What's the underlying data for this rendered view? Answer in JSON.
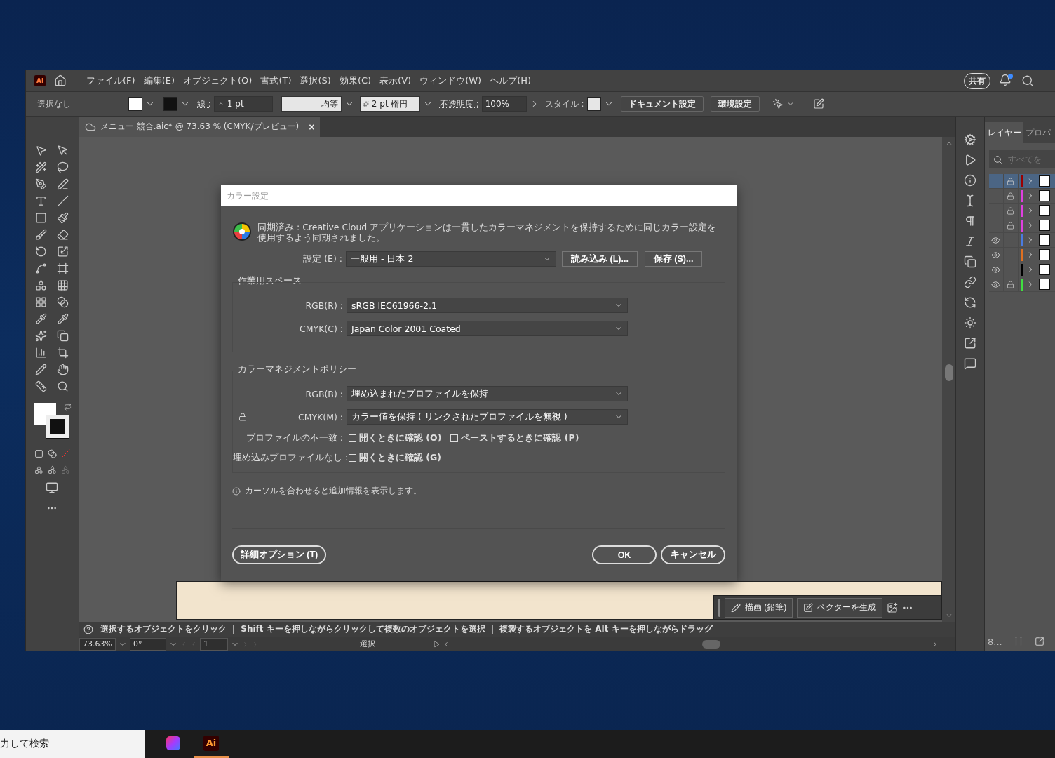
{
  "menubar": {
    "app_badge": "Ai",
    "menus": [
      "ファイル(F)",
      "編集(E)",
      "オブジェクト(O)",
      "書式(T)",
      "選択(S)",
      "効果(C)",
      "表示(V)",
      "ウィンドウ(W)",
      "ヘルプ(H)"
    ],
    "share": "共有",
    "has_notification": true
  },
  "control_bar": {
    "selection": "選択なし",
    "stroke_label": "線 :",
    "stroke_weight": "1 pt",
    "stroke_profile": "均等",
    "brush": "2 pt 楕円",
    "opacity_label": "不透明度 :",
    "opacity": "100%",
    "style_label": "スタイル :",
    "buttons": [
      "ドキュメント設定",
      "環境設定"
    ]
  },
  "document_tab": {
    "title": "メニュー 競合.aic* @ 73.63 % (CMYK/プレビュー)",
    "close": "×"
  },
  "dialog": {
    "title": "カラー設定",
    "sync_message": "同期済み : Creative Cloud アプリケーションは一貫したカラーマネジメントを保持するために同じカラー設定を使用するよう同期されました。",
    "settings": {
      "label": "設定 (E) :",
      "value": "一般用 - 日本 2"
    },
    "load_button": "読み込み (L)...",
    "save_button": "保存 (S)...",
    "working_spaces": {
      "title": "作業用スペース",
      "rows": [
        {
          "label": "RGB(R) :",
          "value": "sRGB IEC61966-2.1"
        },
        {
          "label": "CMYK(C) :",
          "value": "Japan Color 2001 Coated"
        }
      ]
    },
    "policies": {
      "title": "カラーマネジメントポリシー",
      "rows": [
        {
          "label": "RGB(B) :",
          "value": "埋め込まれたプロファイルを保持",
          "locked": false
        },
        {
          "label": "CMYK(M) :",
          "value": "カラー値を保持 ( リンクされたプロファイルを無視 )",
          "locked": true
        }
      ],
      "checks": [
        {
          "label": "プロファイルの不一致 :",
          "options": [
            {
              "label": "開くときに確認 (O)",
              "checked": false
            },
            {
              "label": "ペーストするときに確認 (P)",
              "checked": false
            }
          ]
        },
        {
          "label": "埋め込みプロファイルなし :",
          "options": [
            {
              "label": "開くときに確認 (G)",
              "checked": false
            }
          ]
        }
      ]
    },
    "hint": "カーソルを合わせると追加情報を表示します。",
    "advanced_button": "詳細オプション (T)",
    "ok_button": "OK",
    "cancel_button": "キャンセル"
  },
  "floating_bar": {
    "buttons": [
      "描画 (鉛筆)",
      "ベクターを生成"
    ]
  },
  "status": {
    "hint": "選択するオブジェクトをクリック ｜ Shift キーを押しながらクリックして複数のオブジェクトを選択 ｜ 複製するオブジェクトを Alt キーを押しながらドラッグ",
    "zoom": "73.63%",
    "rotation": "0°",
    "artboard": "1",
    "tool": "選択"
  },
  "layers_panel": {
    "tabs": [
      {
        "label": "レイヤー",
        "selected": true
      },
      {
        "label": "プロパ",
        "selected": false
      }
    ],
    "search_placeholder": "すべてを",
    "count": "8...",
    "layers": [
      {
        "visible": false,
        "locked": true,
        "color": "#9b0000",
        "selected": true
      },
      {
        "visible": false,
        "locked": true,
        "color": "#e040e0",
        "selected": false
      },
      {
        "visible": false,
        "locked": true,
        "color": "#e040e0",
        "selected": false
      },
      {
        "visible": false,
        "locked": true,
        "color": "#e040e0",
        "selected": false
      },
      {
        "visible": true,
        "locked": false,
        "color": "#4a7be0",
        "selected": false
      },
      {
        "visible": true,
        "locked": false,
        "color": "#e07020",
        "selected": false
      },
      {
        "visible": true,
        "locked": false,
        "color": "#000000",
        "selected": false
      },
      {
        "visible": true,
        "locked": true,
        "color": "#40e040",
        "selected": false
      }
    ]
  },
  "taskbar": {
    "search": "力して検索",
    "apps": [
      {
        "kind": "cc",
        "selected": false
      },
      {
        "kind": "ai",
        "label": "Ai",
        "selected": true
      }
    ]
  }
}
